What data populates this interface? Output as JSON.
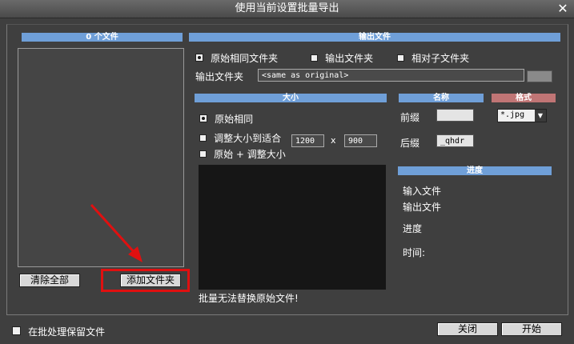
{
  "window": {
    "title": "使用当前设置批量导出",
    "close_glyph": "✕"
  },
  "file_panel": {
    "header": "0 个文件"
  },
  "buttons": {
    "clear_all": "清除全部",
    "add_folder": "添加文件夹",
    "close": "关闭",
    "start": "开始"
  },
  "output": {
    "header": "输出文件",
    "options": [
      {
        "label": "原始相同文件夹",
        "selected": true
      },
      {
        "label": "输出文件夹",
        "selected": false
      },
      {
        "label": "相对子文件夹",
        "selected": false
      }
    ],
    "folder_label": "输出文件夹",
    "folder_value": "<same as original>"
  },
  "size": {
    "header": "大小",
    "options": [
      {
        "label": "原始相同",
        "selected": true
      },
      {
        "label": "调整大小到适合",
        "selected": false
      },
      {
        "label": "原始 + 调整大小",
        "selected": false
      }
    ],
    "width": "1200",
    "times": "x",
    "height": "900"
  },
  "name": {
    "header": "名称",
    "prefix_label": "前缀",
    "prefix_value": "",
    "suffix_label": "后缀",
    "suffix_value": "_qhdr"
  },
  "format": {
    "header": "格式",
    "value": "*.jpg"
  },
  "progress": {
    "header": "进度",
    "input_label": "输入文件",
    "output_label": "输出文件",
    "progress_label": "进度",
    "time_label": "时间:"
  },
  "warning": "批量无法替换原始文件!",
  "keep_files": {
    "label": "在批处理保留文件",
    "checked": false
  },
  "colors": {
    "accent": "#6f9fd8",
    "format_header": "#c07575",
    "highlight": "#e01010"
  }
}
